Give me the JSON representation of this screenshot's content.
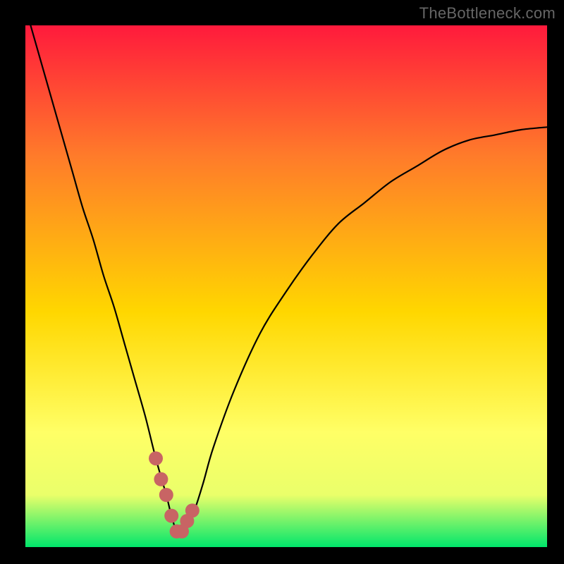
{
  "watermark": "TheBottleneck.com",
  "colors": {
    "bg": "#000000",
    "watermark": "#666666",
    "curve": "#000000",
    "marker": "#c86464",
    "gradient_top": "#ff1a3c",
    "gradient_mid_upper": "#ff7b2a",
    "gradient_mid": "#ffd700",
    "gradient_mid_lower": "#ffff66",
    "gradient_lower": "#eaff6a",
    "gradient_bottom": "#00e66b"
  },
  "chart_data": {
    "type": "line",
    "title": "TheBottleneck.com",
    "xlabel": "",
    "ylabel": "",
    "xlim": [
      0,
      100
    ],
    "ylim": [
      0,
      100
    ],
    "series": [
      {
        "name": "bottleneck-curve",
        "x": [
          1,
          3,
          5,
          7,
          9,
          11,
          13,
          15,
          17,
          19,
          21,
          23,
          25,
          27,
          28,
          29,
          30,
          32,
          34,
          36,
          40,
          45,
          50,
          55,
          60,
          65,
          70,
          75,
          80,
          85,
          90,
          95,
          100
        ],
        "y": [
          100,
          93,
          86,
          79,
          72,
          65,
          59,
          52,
          46,
          39,
          32,
          25,
          17,
          10,
          6,
          3,
          3,
          6,
          12,
          19,
          30,
          41,
          49,
          56,
          62,
          66,
          70,
          73,
          76,
          78,
          79,
          80,
          80.5
        ]
      },
      {
        "name": "highlight-markers",
        "x": [
          25,
          26,
          27,
          28,
          29,
          30,
          31,
          32
        ],
        "y": [
          17,
          13,
          10,
          6,
          3,
          3,
          5,
          7
        ]
      }
    ],
    "gradient_stops": [
      {
        "offset": 0.0,
        "color": "#ff1a3c"
      },
      {
        "offset": 0.25,
        "color": "#ff7b2a"
      },
      {
        "offset": 0.55,
        "color": "#ffd700"
      },
      {
        "offset": 0.78,
        "color": "#ffff66"
      },
      {
        "offset": 0.9,
        "color": "#eaff6a"
      },
      {
        "offset": 1.0,
        "color": "#00e66b"
      }
    ]
  }
}
